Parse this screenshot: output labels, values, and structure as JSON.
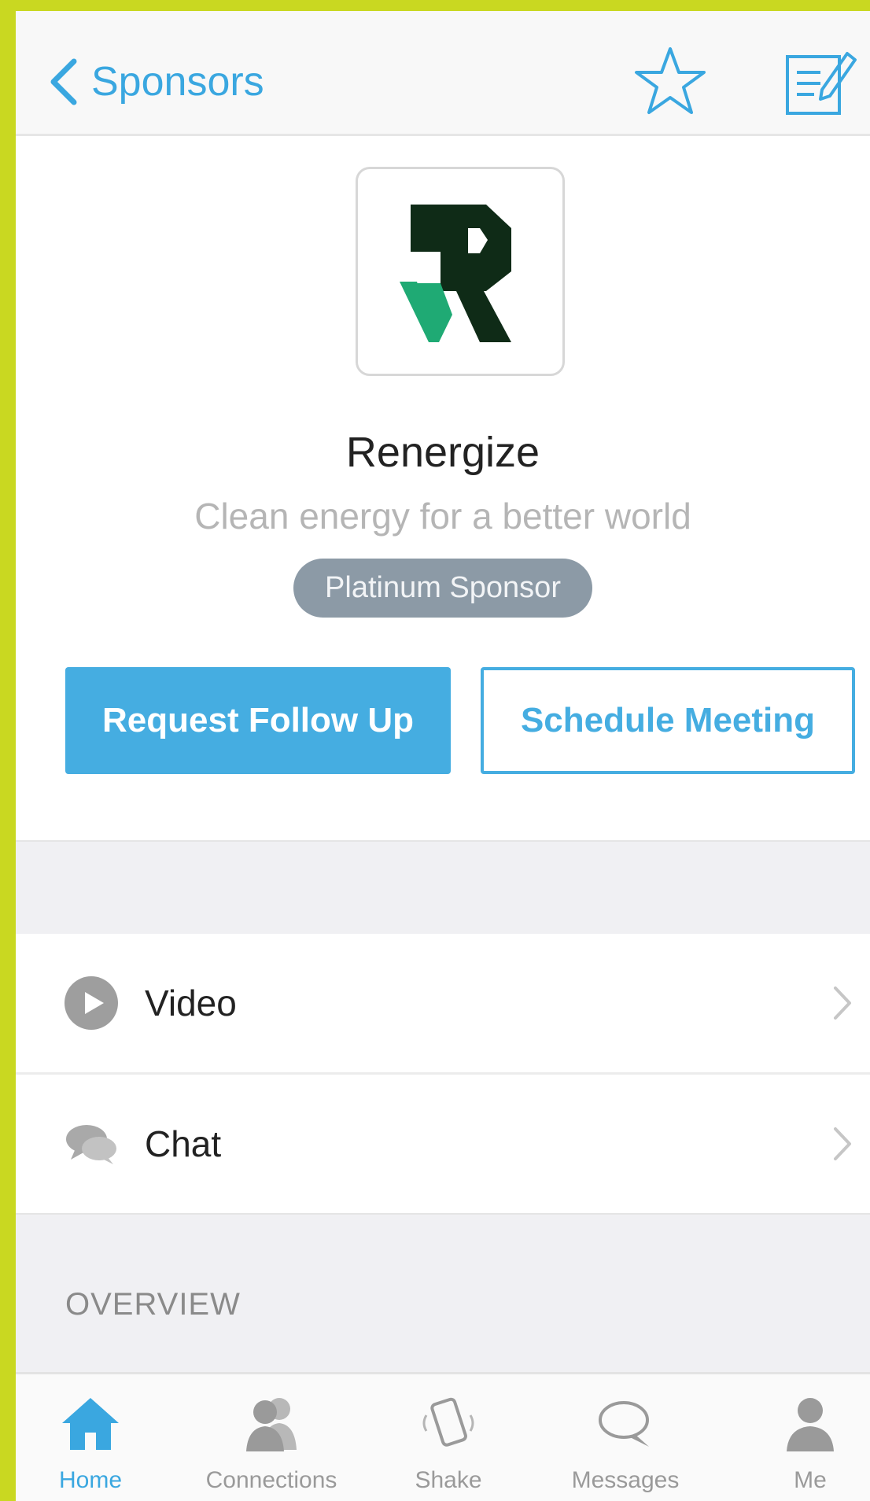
{
  "colors": {
    "accent": "#45ade1",
    "frame": "#c9d821",
    "badge": "#8c9aa6"
  },
  "navbar": {
    "back_label": "Sponsors",
    "back_icon": "chevron-left-icon",
    "favorite_icon": "star-icon",
    "notes_icon": "note-edit-icon"
  },
  "sponsor": {
    "name": "Renergize",
    "tagline": "Clean energy for a better world",
    "badge": "Platinum Sponsor",
    "logo_icon": "renergize-logo"
  },
  "actions": {
    "request_follow_up": "Request Follow Up",
    "schedule_meeting": "Schedule Meeting"
  },
  "links": [
    {
      "label": "Video",
      "icon": "play-icon"
    },
    {
      "label": "Chat",
      "icon": "chat-bubbles-icon"
    }
  ],
  "section_header": "OVERVIEW",
  "tabbar": {
    "active": "Home",
    "items": [
      {
        "label": "Home",
        "icon": "home-icon"
      },
      {
        "label": "Connections",
        "icon": "people-icon"
      },
      {
        "label": "Shake",
        "icon": "shake-phone-icon"
      },
      {
        "label": "Messages",
        "icon": "speech-bubble-icon"
      },
      {
        "label": "Me",
        "icon": "person-icon"
      }
    ]
  }
}
